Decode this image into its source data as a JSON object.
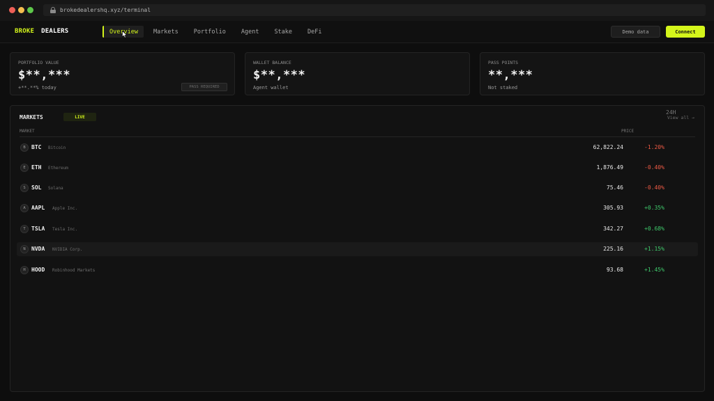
{
  "browser": {
    "url": "brokedealershq.xyz/terminal"
  },
  "nav": {
    "logo_part1": "BROKE",
    "logo_part2": "DEALERS",
    "items": [
      {
        "label": "Overview",
        "active": true
      },
      {
        "label": "Markets",
        "active": false
      },
      {
        "label": "Portfolio",
        "active": false
      },
      {
        "label": "Agent",
        "active": false
      },
      {
        "label": "Stake",
        "active": false
      },
      {
        "label": "DeFi",
        "active": false
      }
    ],
    "demo_label": "Demo data",
    "connect_label": "Connect"
  },
  "cards": [
    {
      "label": "PORTFOLIO VALUE",
      "value": "$**,***",
      "sub": "+**.**% today",
      "button": "PASS REQUIRED"
    },
    {
      "label": "WALLET BALANCE",
      "value": "$**,***",
      "sub": "Agent wallet"
    },
    {
      "label": "PASS POINTS",
      "value": "**,***",
      "sub": "Not staked"
    }
  ],
  "markets": {
    "title": "MARKETS",
    "badge": "LIVE",
    "view_all": "View all →",
    "headers": {
      "market": "MARKET",
      "price": "PRICE",
      "change": "24H"
    },
    "rows": [
      {
        "initial": "B",
        "symbol": "BTC",
        "name": "Bitcoin",
        "price": "62,822.24",
        "change": "-1.20%",
        "direction": "down"
      },
      {
        "initial": "E",
        "symbol": "ETH",
        "name": "Ethereum",
        "price": "1,876.49",
        "change": "-0.40%",
        "direction": "down"
      },
      {
        "initial": "S",
        "symbol": "SOL",
        "name": "Solana",
        "price": "75.46",
        "change": "-0.40%",
        "direction": "down"
      },
      {
        "initial": "A",
        "symbol": "AAPL",
        "name": "Apple Inc.",
        "price": "305.93",
        "change": "+0.35%",
        "direction": "up"
      },
      {
        "initial": "T",
        "symbol": "TSLA",
        "name": "Tesla Inc.",
        "price": "342.27",
        "change": "+0.68%",
        "direction": "up"
      },
      {
        "initial": "N",
        "symbol": "NVDA",
        "name": "NVIDIA Corp.",
        "price": "225.16",
        "change": "+1.15%",
        "direction": "up",
        "hovered": true
      },
      {
        "initial": "H",
        "symbol": "HOOD",
        "name": "Robinhood Markets",
        "price": "93.68",
        "change": "+1.45%",
        "direction": "up"
      }
    ]
  },
  "colors": {
    "accent": "#d4f51b",
    "negative": "#ef5a45",
    "positive": "#3fcb6c",
    "background": "#0e0e0e"
  }
}
